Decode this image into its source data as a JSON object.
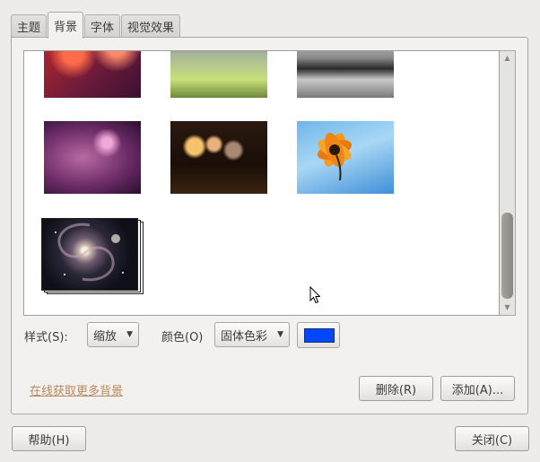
{
  "tabs": [
    {
      "label": "主题",
      "active": false
    },
    {
      "label": "背景",
      "active": true
    },
    {
      "label": "字体",
      "active": false
    },
    {
      "label": "视觉效果",
      "active": false
    }
  ],
  "style_control": {
    "label": "样式(S):",
    "value": "缩放"
  },
  "color_control": {
    "label": "颜色(O)",
    "value": "固体色彩",
    "swatch_color": "#0048ff"
  },
  "online_link": "在线获取更多背景",
  "buttons": {
    "remove": "删除(R)",
    "add": "添加(A)...",
    "help": "帮助(H)",
    "close": "关闭(C)"
  },
  "wallpapers": [
    {
      "name": "red-bokeh"
    },
    {
      "name": "green-glass"
    },
    {
      "name": "grey-glass"
    },
    {
      "name": "purple-bokeh"
    },
    {
      "name": "warm-bokeh-lights"
    },
    {
      "name": "orange-flower"
    },
    {
      "name": "galaxy",
      "selected": true
    }
  ],
  "icons": {
    "scroll_up": "up-arrow-icon",
    "scroll_down": "down-arrow-icon",
    "combo_arrow": "triangle-down-icon",
    "cursor": "mouse-pointer-icon"
  }
}
